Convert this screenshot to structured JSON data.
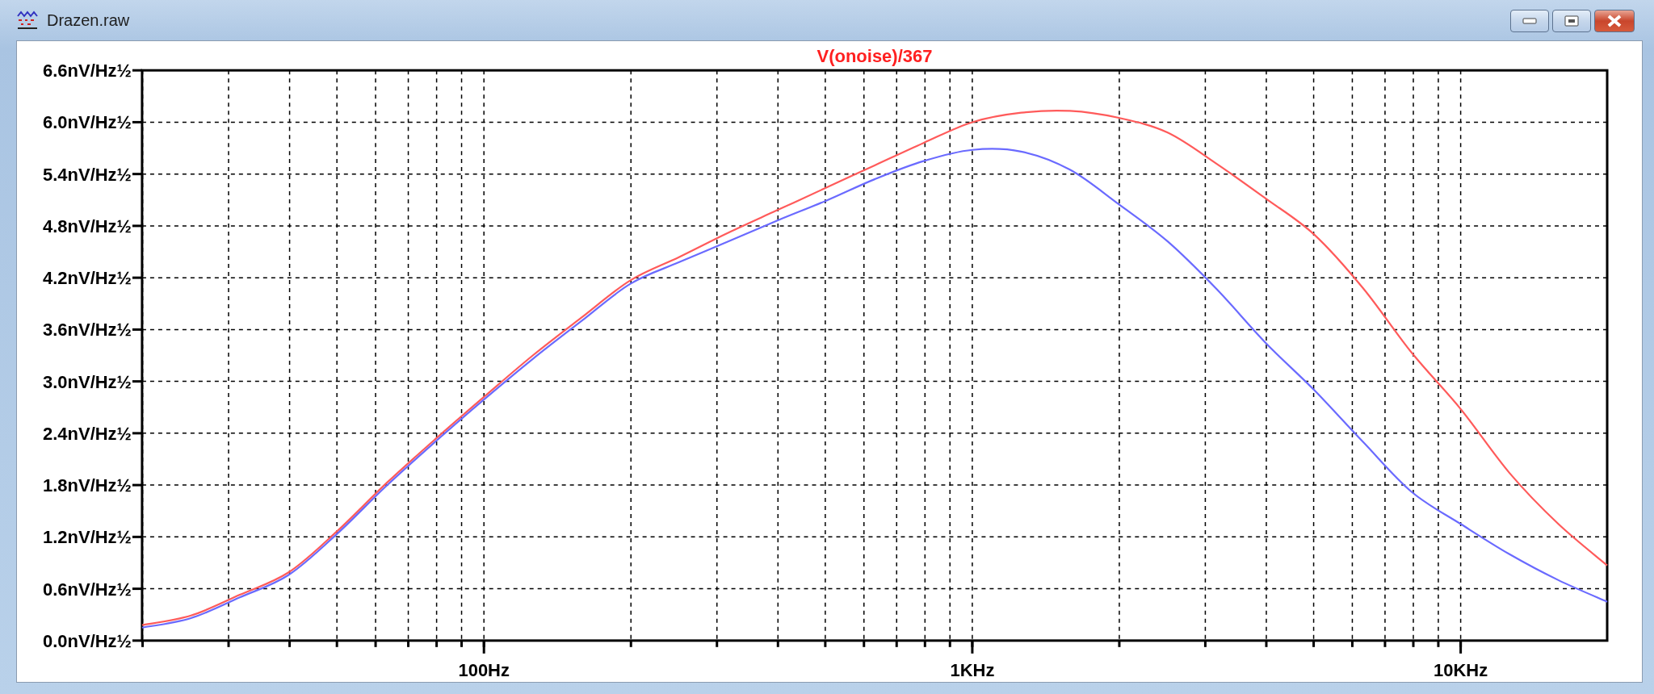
{
  "window": {
    "title": "Drazen.raw"
  },
  "plot": {
    "chart_data": {
      "type": "line",
      "title": "V(onoise)/367",
      "grid": true,
      "categories": [
        null,
        null,
        null,
        null,
        null,
        null,
        null,
        "100Hz",
        null,
        null,
        null,
        null,
        null,
        null,
        null,
        null,
        null,
        "1KHz",
        null,
        null,
        null,
        null,
        null,
        null,
        null,
        null,
        null,
        "10KHz",
        null,
        null,
        null
      ],
      "series": [
        {
          "color": "#ff5a5a",
          "values": [
            0.18,
            0.29,
            0.53,
            0.79,
            1.27,
            1.82,
            2.33,
            2.82,
            3.3,
            3.74,
            4.17,
            4.44,
            4.72,
            4.98,
            5.24,
            5.5,
            5.76,
            6.0,
            6.11,
            6.13,
            6.05,
            5.88,
            5.52,
            5.12,
            4.7,
            4.08,
            3.33,
            2.68,
            1.94,
            1.35,
            0.87
          ]
        },
        {
          "color": "#6a6aff",
          "values": [
            0.15,
            0.26,
            0.5,
            0.76,
            1.24,
            1.79,
            2.3,
            2.79,
            3.26,
            3.7,
            4.13,
            4.38,
            4.62,
            4.86,
            5.09,
            5.34,
            5.55,
            5.68,
            5.66,
            5.45,
            5.05,
            4.62,
            4.07,
            3.45,
            2.9,
            2.3,
            1.72,
            1.35,
            1.0,
            0.7,
            0.45
          ]
        }
      ],
      "ylim": [
        0,
        6.6
      ],
      "yticks": [
        {
          "value": 0,
          "label": "0.0nV/Hz½"
        },
        {
          "value": 0.6,
          "label": "0.6nV/Hz½"
        },
        {
          "value": 1.2,
          "label": "1.2nV/Hz½"
        },
        {
          "value": 1.8,
          "label": "1.8nV/Hz½"
        },
        {
          "value": 2.4,
          "label": "2.4nV/Hz½"
        },
        {
          "value": 3.0,
          "label": "3.0nV/Hz½"
        },
        {
          "value": 3.6,
          "label": "3.6nV/Hz½"
        },
        {
          "value": 4.2,
          "label": "4.2nV/Hz½"
        },
        {
          "value": 4.8,
          "label": "4.8nV/Hz½"
        },
        {
          "value": 5.4,
          "label": "5.4nV/Hz½"
        },
        {
          "value": 6.0,
          "label": "6.0nV/Hz½"
        },
        {
          "value": 6.6,
          "label": "6.6nV/Hz½"
        }
      ]
    }
  }
}
